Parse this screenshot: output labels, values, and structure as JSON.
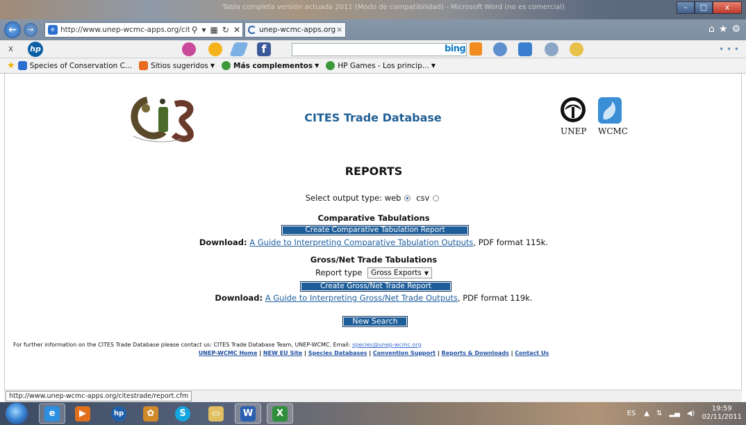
{
  "window": {
    "title": "Tabla completa versión actuada 2011 (Modo de compatibilidad) - Microsoft Word (no es comercial)",
    "minimize_glyph": "–",
    "maximize_glyph": "□",
    "close_glyph": "x"
  },
  "browser": {
    "back_glyph": "←",
    "forward_glyph": "→",
    "address_url": "http://www.unep-wcmc-apps.org/citest",
    "address_controls": [
      "⚲",
      "▾",
      "▦",
      "↻",
      "✕"
    ],
    "tab_label": "unep-wcmc-apps.org",
    "tab_close": "×",
    "right_icons": [
      "⌂",
      "★",
      "⚙"
    ]
  },
  "hp_toolbar": {
    "close_glyph": "x",
    "hp_logo_text": "hp",
    "facebook_text": "f",
    "bing_text": "bing",
    "more_glyph": "• • •"
  },
  "favorites": {
    "items": [
      {
        "label": "Species of Conservation C...",
        "has_caret": false,
        "bold": false,
        "icon": "ie-page-icon",
        "color": "#2a6ed0"
      },
      {
        "label": "Sitios sugeridos",
        "has_caret": true,
        "bold": false,
        "icon": "suggested-sites-icon",
        "color": "#e86a1e"
      },
      {
        "label": "Más complementos",
        "has_caret": true,
        "bold": true,
        "icon": "addons-icon",
        "color": "#3c9a3c"
      },
      {
        "label": "HP Games - Los princip...",
        "has_caret": true,
        "bold": false,
        "icon": "hp-games-icon",
        "color": "#3c9a3c"
      }
    ],
    "caret": "▼"
  },
  "page": {
    "db_title": "CITES Trade Database",
    "unep_label": "UNEP",
    "wcmc_label": "WCMC",
    "reports_heading": "REPORTS",
    "output_type_label": "Select output type:",
    "output_web": "web",
    "output_csv": "csv",
    "comparative": {
      "heading": "Comparative Tabulations",
      "button": "Create Comparative Tabulation Report",
      "download_label": "Download:",
      "download_link": "A Guide to Interpreting Comparative Tabulation Outputs",
      "download_suffix": ", PDF format 115k."
    },
    "grossnet": {
      "heading": "Gross/Net Trade Tabulations",
      "report_type_label": "Report type",
      "report_type_value": "Gross Exports",
      "button": "Create Gross/Net Trade Report",
      "download_label": "Download:",
      "download_link": "A Guide to Interpreting Gross/Net Trade Outputs",
      "download_suffix": ", PDF format 119k."
    },
    "new_search": "New Search",
    "footer_text": "For further information on the CITES Trade Database please contact us: CITES Trade Database Team, UNEP-WCMC. Email: ",
    "footer_email": "species@unep-wcmc.org",
    "footer_links": [
      "UNEP-WCMC Home",
      "NEW EU Site",
      "Species Databases",
      "Convention Support",
      "Reports & Downloads",
      "Contact Us"
    ],
    "footer_sep": " | "
  },
  "status": {
    "url": "http://www.unep-wcmc-apps.org/citestrade/report.cfm"
  },
  "taskbar": {
    "apps": [
      {
        "name": "ie-taskbar-icon",
        "glyph": "e",
        "color": "#2c8fe0",
        "active": true
      },
      {
        "name": "media-taskbar-icon",
        "glyph": "▶",
        "color": "#e0701c",
        "active": false
      },
      {
        "name": "hp-taskbar-icon",
        "glyph": "hp",
        "color": "#1f5fa8",
        "active": false
      },
      {
        "name": "paint-taskbar-icon",
        "glyph": "✿",
        "color": "#d08a2a",
        "active": false
      },
      {
        "name": "skype-taskbar-icon",
        "glyph": "S",
        "color": "#12a5e0",
        "active": false
      },
      {
        "name": "folder-taskbar-icon",
        "glyph": "▭",
        "color": "#e0c060",
        "active": false
      },
      {
        "name": "word-taskbar-icon",
        "glyph": "W",
        "color": "#2b5fb0",
        "active": true
      },
      {
        "name": "excel-taskbar-icon",
        "glyph": "X",
        "color": "#2f8f3a",
        "active": true
      }
    ],
    "lang": "ES",
    "tray_icons": [
      "▲",
      "⇅",
      "▂▄",
      "◀)"
    ],
    "time": "19:59",
    "date": "02/11/2011"
  }
}
